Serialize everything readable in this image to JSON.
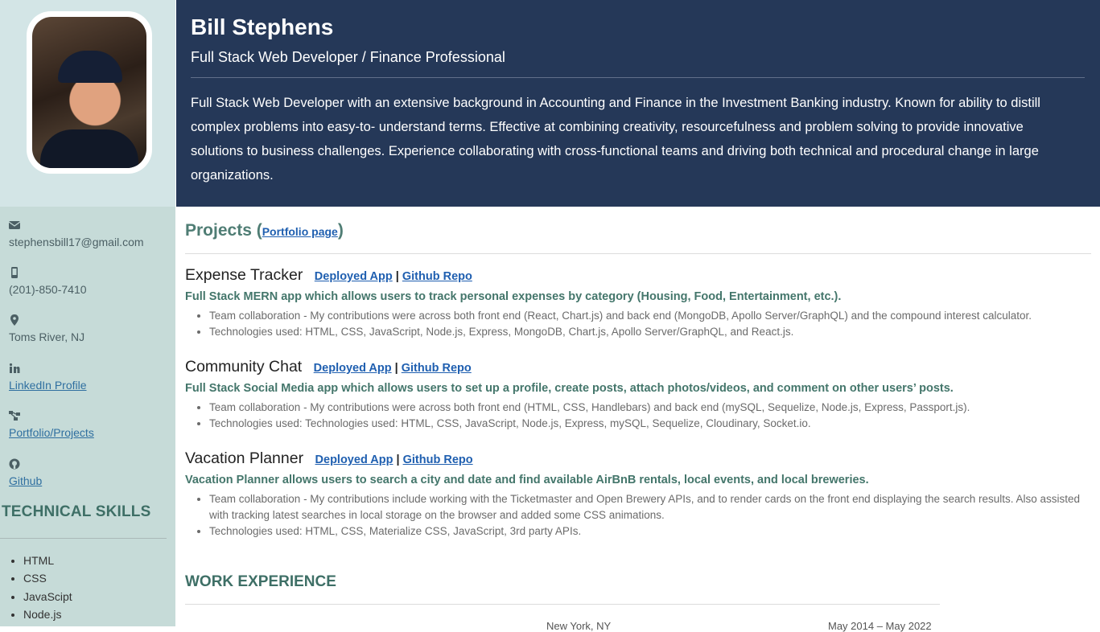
{
  "profile": {
    "name": "Bill Stephens",
    "title": "Full Stack Web Developer / Finance Professional",
    "summary": "Full Stack Web Developer with an extensive background in Accounting and Finance in the Investment Banking industry. Known for ability to distill complex problems into easy-to- understand terms. Effective at combining creativity, resourcefulness and problem solving to provide innovative solutions to business challenges. Experience collaborating with cross-functional teams and driving both technical and procedural change in large organizations."
  },
  "contact": {
    "email": "stephensbill17@gmail.com",
    "phone": "(201)-850-7410",
    "location": "Toms River, NJ",
    "linkedin": "LinkedIn Profile",
    "portfolio": "Portfolio/Projects",
    "github": "Github"
  },
  "skills": {
    "title": "TECHNICAL SKILLS",
    "items": [
      "HTML",
      "CSS",
      "JavaScipt",
      "Node.js"
    ]
  },
  "projects": {
    "heading": "Projects (",
    "heading_link": "Portfolio page",
    "heading_close": ")",
    "deployed_label": "Deployed App",
    "separator": "|",
    "repo_label": "Github Repo",
    "items": [
      {
        "title": "Expense Tracker",
        "desc": "Full Stack MERN app which allows users to track personal expenses by category (Housing, Food, Entertainment, etc.).",
        "bullets": [
          "Team collaboration - My contributions were across both front end (React, Chart.js) and back end (MongoDB, Apollo Server/GraphQL) and the compound interest calculator.",
          "Technologies used: HTML, CSS, JavaScript, Node.js, Express, MongoDB, Chart.js, Apollo Server/GraphQL, and React.js."
        ]
      },
      {
        "title": "Community Chat",
        "desc": "Full Stack Social Media app which allows users to set up a profile, create posts, attach photos/videos, and comment on other users’ posts.",
        "bullets": [
          "Team collaboration - My contributions were across both front end (HTML, CSS, Handlebars) and back end (mySQL, Sequelize, Node.js, Express, Passport.js).",
          "Technologies used: Technologies used: HTML, CSS, JavaScript, Node.js, Express, mySQL, Sequelize, Cloudinary, Socket.io."
        ]
      },
      {
        "title": "Vacation Planner",
        "desc": "Vacation Planner allows users to search a city and date and find available AirBnB rentals, local events, and local breweries.",
        "bullets": [
          "Team collaboration - My contributions include working with the Ticketmaster and Open Brewery APIs, and to render cards on the front end displaying the search results. Also assisted with tracking latest searches in local storage on the browser and added some CSS animations.",
          "Technologies used: HTML, CSS, Materialize CSS, JavaScript, 3rd party APIs."
        ]
      }
    ]
  },
  "work": {
    "title": "WORK EXPERIENCE",
    "location": "New York, NY",
    "dates": "May 2014 – May 2022"
  }
}
